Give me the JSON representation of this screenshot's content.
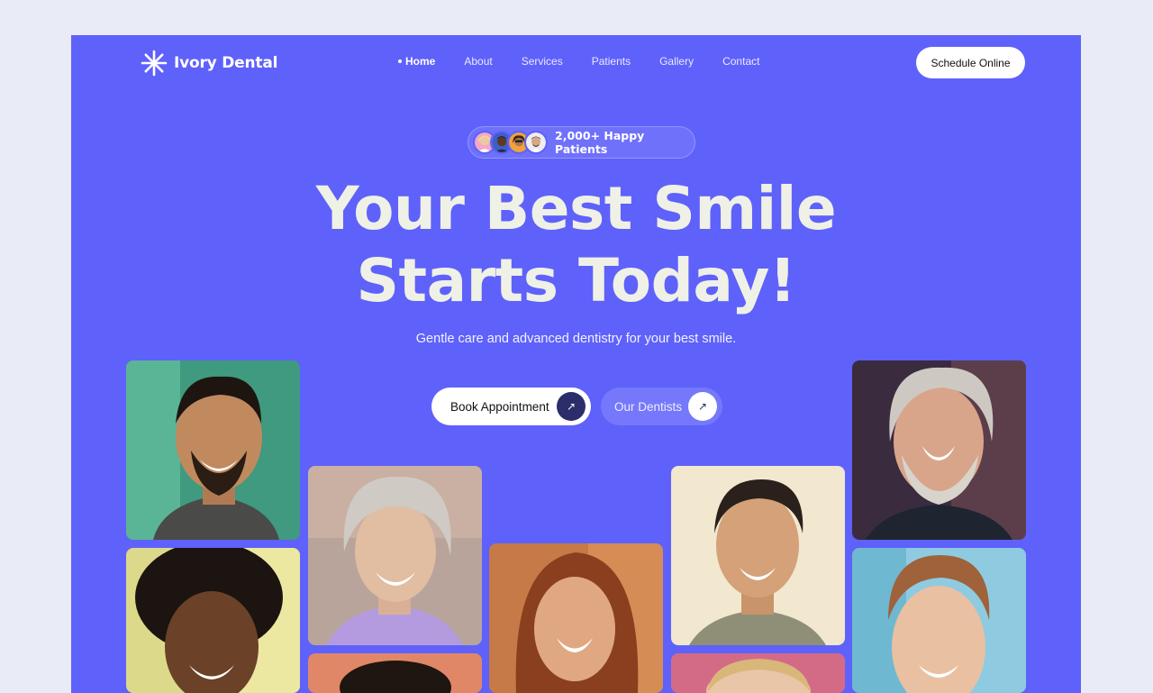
{
  "brand": {
    "name": "Ivory Dental",
    "icon": "asterisk-icon"
  },
  "nav": {
    "items": [
      {
        "label": "Home",
        "active": true
      },
      {
        "label": "About",
        "active": false
      },
      {
        "label": "Services",
        "active": false
      },
      {
        "label": "Patients",
        "active": false
      },
      {
        "label": "Gallery",
        "active": false
      },
      {
        "label": "Contact",
        "active": false
      }
    ],
    "cta_label": "Schedule Online"
  },
  "hero": {
    "badge_text": "2,000+ Happy Patients",
    "headline_line1": "Your Best Smile",
    "headline_line2": "Starts Today!",
    "subtitle": "Gentle care and advanced dentistry for your best smile.",
    "primary_button": "Book Appointment",
    "secondary_button": "Our Dentists"
  },
  "colors": {
    "page_background": "#e9ebf6",
    "hero_background": "#5f61fb",
    "headline": "#eff1e6",
    "dark_accent": "#2b2e6b"
  }
}
